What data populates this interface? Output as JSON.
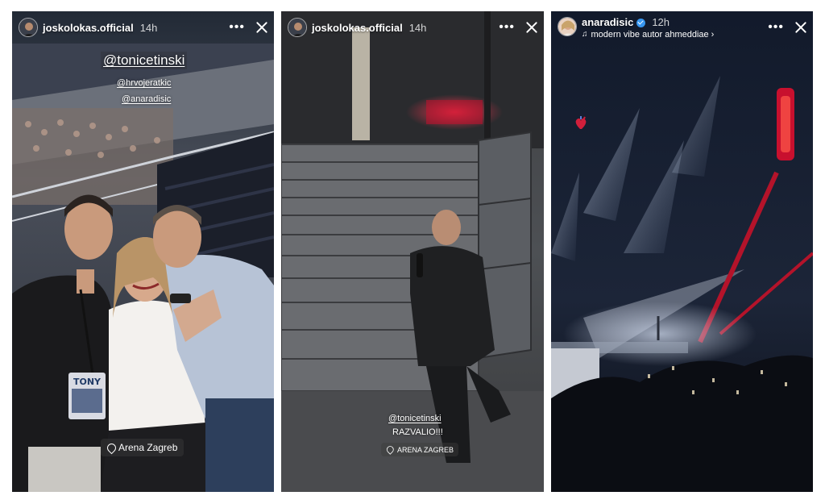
{
  "stories": [
    {
      "username": "joskolokas.official",
      "time": "14h",
      "mentions": [
        "@tonicetinski",
        "@hrvojeratkic",
        "@anaradisic"
      ],
      "location": "Arena Zagreb",
      "badge_text": "TONY"
    },
    {
      "username": "joskolokas.official",
      "time": "14h",
      "mention": "@tonicetinski",
      "caption": "RAZVALIO!!!",
      "location": "ARENA ZAGREB"
    },
    {
      "username": "anaradisic",
      "time": "12h",
      "music": "modern vibe autor ahmeddiae"
    }
  ],
  "icons": {
    "more": "more-options-icon",
    "close": "close-icon",
    "location": "location-pin-icon",
    "verified": "verified-badge-icon",
    "music": "music-note-icon",
    "heart": "anatomical-heart-sticker"
  },
  "colors": {
    "arena_red": "#c8102e",
    "stage_dark": "#1b2233",
    "verified_blue": "#3897f0"
  }
}
